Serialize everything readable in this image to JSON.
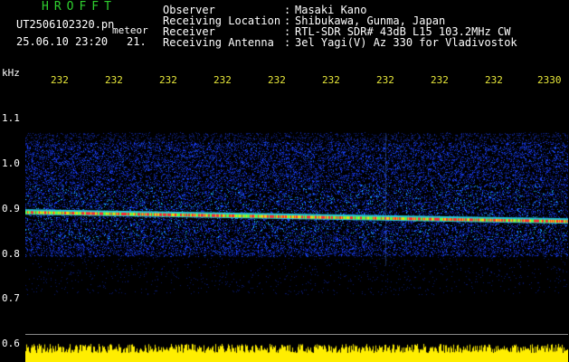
{
  "header": {
    "app_title": "HROFFT",
    "file_name": "UT2506102320.pn",
    "detection": "meteor",
    "timestamp": "25.06.10 23:20",
    "frame": "21."
  },
  "info": [
    {
      "label": "Observer",
      "value": "Masaki Kano"
    },
    {
      "label": "Receiving Location",
      "value": "Shibukawa, Gunma, Japan"
    },
    {
      "label": "Receiver",
      "value": "RTL-SDR SDR# 43dB L15 103.2MHz CW"
    },
    {
      "label": "Receiving Antenna",
      "value": "3el Yagi(V) Az 330 for Vladivostok"
    }
  ],
  "axis": {
    "y_unit": "kHz",
    "y_ticks": [
      "1.1",
      "1.0",
      "0.9",
      "0.8",
      "0.7",
      "0.6"
    ],
    "x_ticks": [
      "232",
      "232",
      "232",
      "232",
      "232",
      "232",
      "232",
      "232",
      "232",
      "2330"
    ]
  },
  "colors": {
    "background": "#000000",
    "title": "#2fd02f",
    "text": "#ffffff",
    "ticks": "#e8e83a",
    "noise": "#1a3cff",
    "signal_line": "#ff2a2a",
    "amplitude": "#ffee00"
  },
  "spectrogram": {
    "freq_range_khz": [
      0.6,
      1.1
    ],
    "signal_freq_khz": 0.87,
    "noise_band_khz": [
      0.78,
      1.02
    ]
  }
}
